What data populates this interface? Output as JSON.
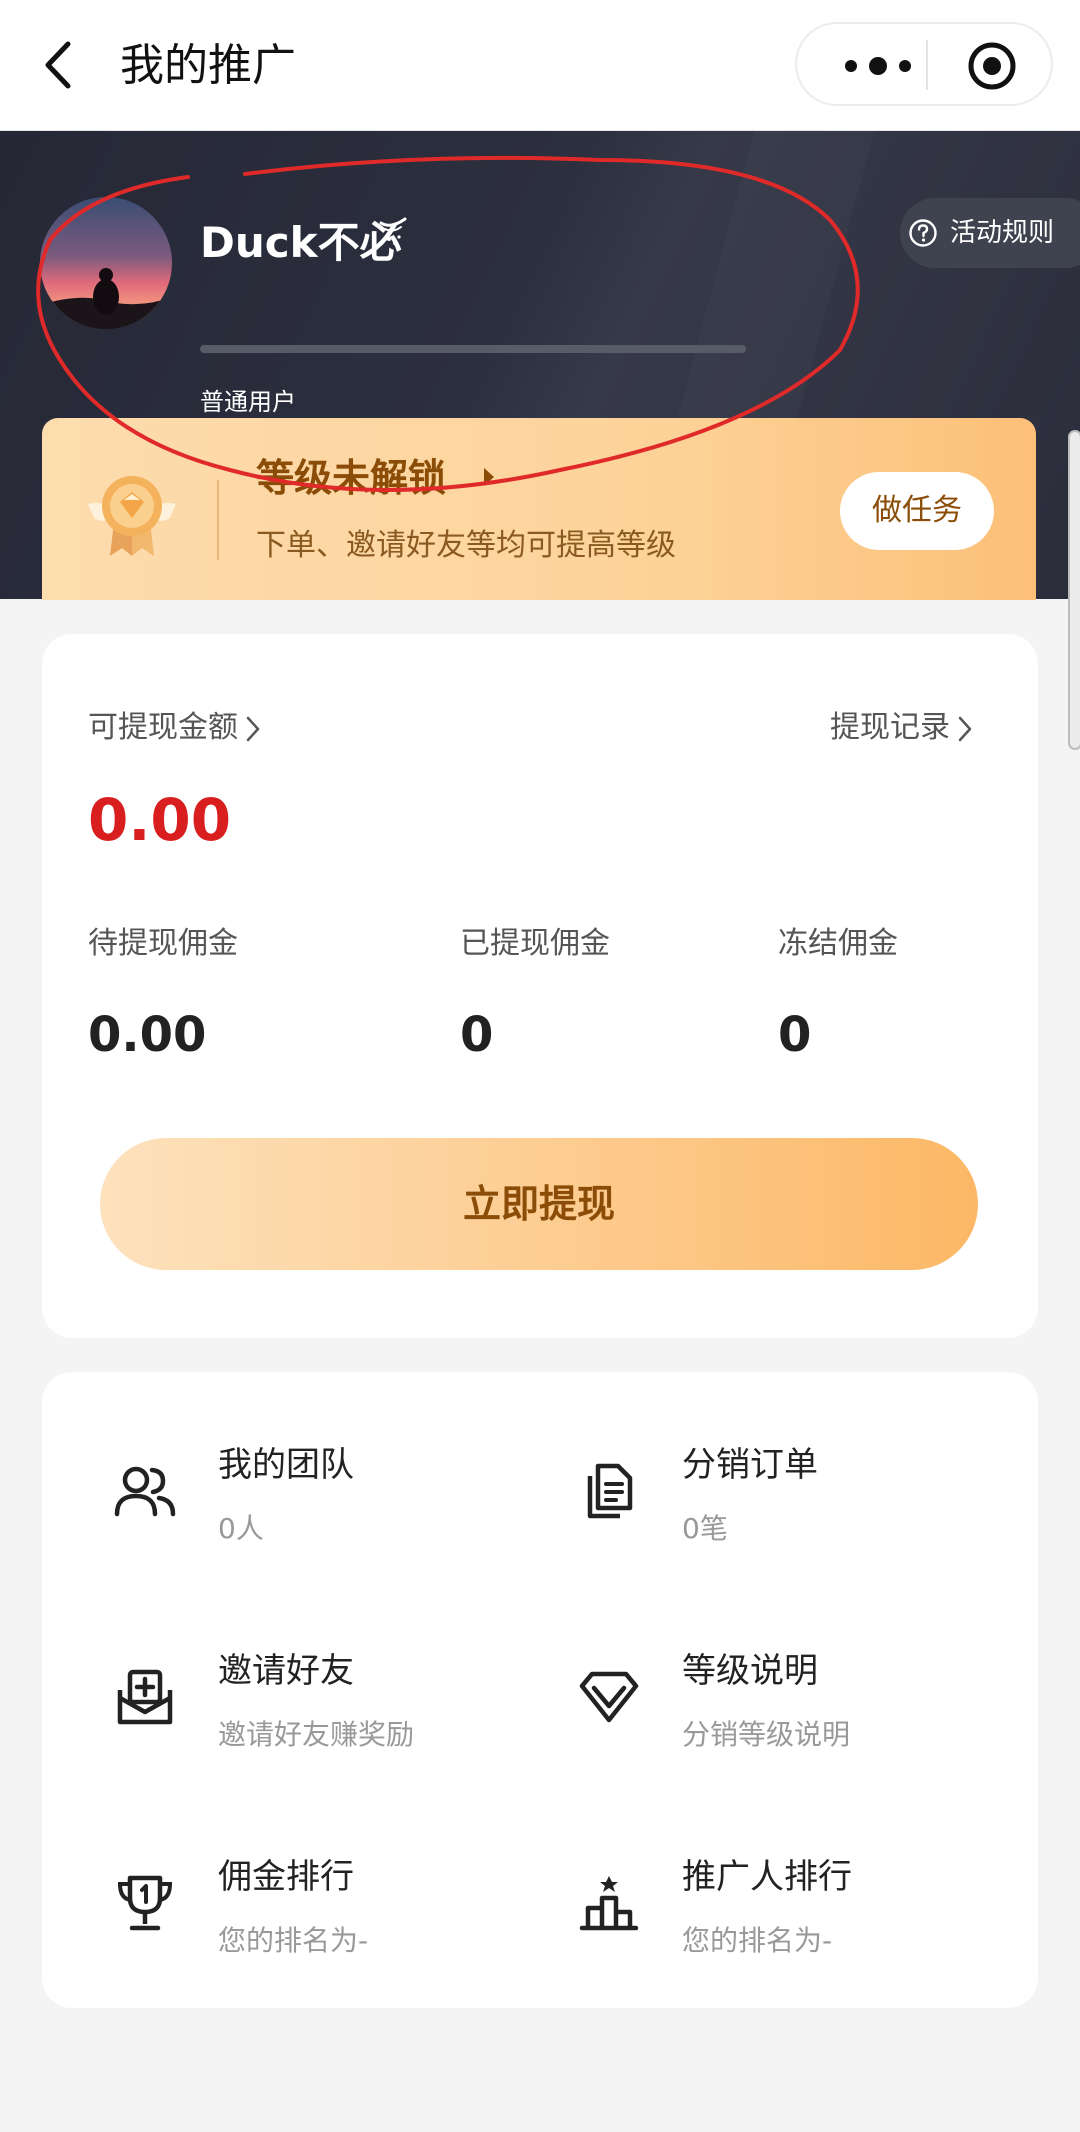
{
  "nav": {
    "title": "我的推广"
  },
  "profile": {
    "username": "Duck不必",
    "level_name": "普通用户",
    "rules_label": "活动规则"
  },
  "level_card": {
    "title": "等级未解锁",
    "subtitle": "下单、邀请好友等均可提高等级",
    "task_button": "做任务"
  },
  "wallet": {
    "withdrawable_label": "可提现金额",
    "records_label": "提现记录",
    "balance": "0.00",
    "stats": [
      {
        "label": "待提现佣金",
        "value": "0.00"
      },
      {
        "label": "已提现佣金",
        "value": "0"
      },
      {
        "label": "冻结佣金",
        "value": "0"
      }
    ],
    "withdraw_button": "立即提现"
  },
  "menu": [
    {
      "title": "我的团队",
      "subtitle": "0人",
      "icon": "team-icon"
    },
    {
      "title": "分销订单",
      "subtitle": "0笔",
      "icon": "order-document-icon"
    },
    {
      "title": "邀请好友",
      "subtitle": "邀请好友赚奖励",
      "icon": "invite-mail-icon"
    },
    {
      "title": "等级说明",
      "subtitle": "分销等级说明",
      "icon": "diamond-icon"
    },
    {
      "title": "佣金排行",
      "subtitle": "您的排名为-",
      "icon": "trophy-icon"
    },
    {
      "title": "推广人排行",
      "subtitle": "您的排名为-",
      "icon": "podium-icon"
    }
  ],
  "colors": {
    "balance_red": "#d81e1e",
    "accent_brown": "#8a4c07",
    "hero_dark": "#2a2c3a",
    "gold_light": "#fddcae",
    "gold_dark": "#fcb866",
    "annotation_red": "#e02a2a"
  }
}
